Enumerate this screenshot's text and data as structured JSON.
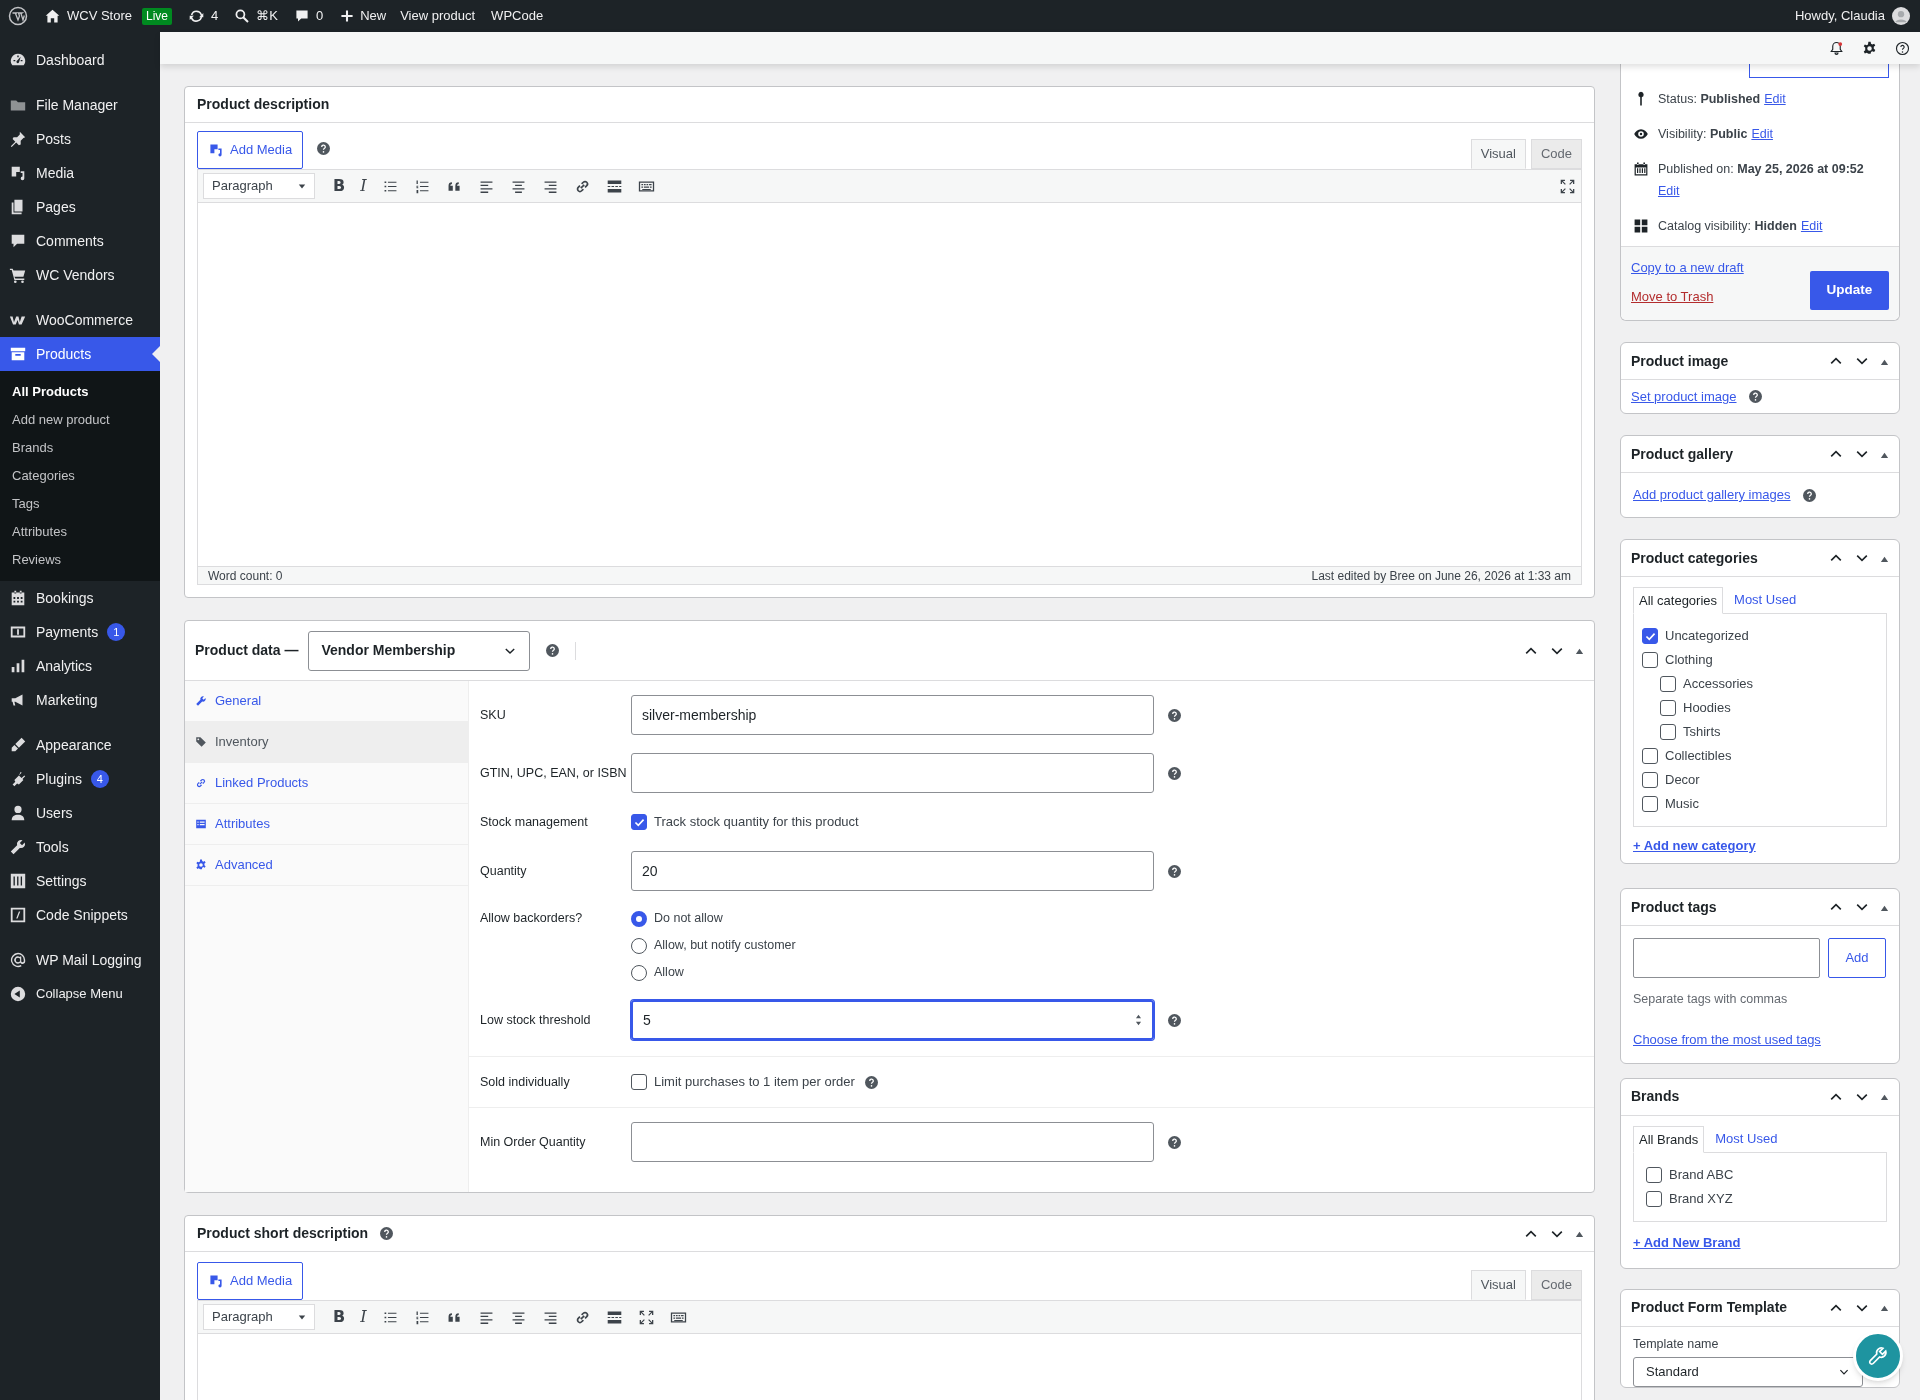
{
  "admin_bar": {
    "site": "WCV Store",
    "badge": "Live",
    "updates": "4",
    "search": "⌘K",
    "comments": "0",
    "new": "New",
    "links": [
      "View product",
      "WPCode"
    ],
    "account": "Howdy, Claudia"
  },
  "sidebar": {
    "groups": [
      [
        {
          "label": "Dashboard",
          "selected": false
        }
      ],
      [
        {
          "label": "File Manager",
          "selected": false
        },
        {
          "label": "Posts",
          "selected": false
        },
        {
          "label": "Media",
          "selected": false
        },
        {
          "label": "Pages",
          "selected": false
        },
        {
          "label": "Comments",
          "selected": false
        },
        {
          "label": "WC Vendors",
          "selected": false
        }
      ],
      [
        {
          "label": "WooCommerce",
          "selected": false
        },
        {
          "label": "Products",
          "selected": true,
          "children": [
            {
              "label": "All Products",
              "selected": true
            },
            {
              "label": "Add new product",
              "selected": false
            },
            {
              "label": "Brands",
              "selected": false
            },
            {
              "label": "Categories",
              "selected": false
            },
            {
              "label": "Tags",
              "selected": false
            },
            {
              "label": "Attributes",
              "selected": false
            },
            {
              "label": "Reviews",
              "selected": false
            }
          ]
        },
        {
          "label": "Bookings",
          "selected": false
        },
        {
          "label": "Payments",
          "selected": false,
          "badge": "1"
        },
        {
          "label": "Analytics",
          "selected": false
        },
        {
          "label": "Marketing",
          "selected": false
        }
      ],
      [
        {
          "label": "Appearance",
          "selected": false
        },
        {
          "label": "Plugins",
          "selected": false,
          "badge": "4"
        },
        {
          "label": "Users",
          "selected": false
        },
        {
          "label": "Tools",
          "selected": false
        },
        {
          "label": "Settings",
          "selected": false
        },
        {
          "label": "Code Snippets",
          "selected": false
        }
      ],
      [
        {
          "label": "WP Mail Logging",
          "selected": false
        }
      ]
    ],
    "collapse": "Collapse Menu"
  },
  "description": {
    "title": "Product description",
    "add_media": "Add Media",
    "tabs": [
      {
        "label": "Visual",
        "selected": true
      },
      {
        "label": "Code",
        "selected": false
      }
    ],
    "toolbar": {
      "format": "Paragraph",
      "bold": "B",
      "italic": "I"
    },
    "word_count": "Word count: 0",
    "last_edited": "Last edited by Bree on June 26, 2026 at 1:33 am"
  },
  "product_data": {
    "title": "Product data —",
    "type": "Vendor Membership",
    "tabs": [
      {
        "label": "General",
        "selected": false
      },
      {
        "label": "Inventory",
        "selected": true
      },
      {
        "label": "Linked Products",
        "selected": false
      },
      {
        "label": "Attributes",
        "selected": false
      },
      {
        "label": "Advanced",
        "selected": false
      }
    ],
    "field_groups": [
      [
        {
          "kind": "text",
          "label": "SKU",
          "value": "silver-membership",
          "focused": false
        },
        {
          "kind": "text",
          "label": "GTIN, UPC, EAN, or ISBN",
          "focused": false
        },
        {
          "kind": "checkbox",
          "label": "Stock management",
          "text": "Track stock quantity for this product",
          "checked": true,
          "help": false
        },
        {
          "kind": "text",
          "label": "Quantity",
          "value": "20",
          "focused": false
        },
        {
          "kind": "radio",
          "label": "Allow backorders?",
          "options": [
            {
              "label": "Do not allow",
              "selected": true
            },
            {
              "label": "Allow, but notify customer",
              "selected": false
            },
            {
              "label": "Allow",
              "selected": false
            }
          ]
        },
        {
          "kind": "number",
          "label": "Low stock threshold",
          "value": "5",
          "focused": true
        }
      ],
      [
        {
          "kind": "checkbox",
          "label": "Sold individually",
          "text": "Limit purchases to 1 item per order",
          "checked": false,
          "help": true
        }
      ],
      [
        {
          "kind": "text",
          "label": "Min Order Quantity",
          "focused": false
        }
      ]
    ]
  },
  "short_description": {
    "title": "Product short description",
    "add_media": "Add Media",
    "tabs": [
      {
        "label": "Visual",
        "selected": true
      },
      {
        "label": "Code",
        "selected": false
      }
    ],
    "toolbar": {
      "format": "Paragraph",
      "bold": "B",
      "italic": "I"
    }
  },
  "publish": {
    "rows": [
      {
        "text": "Status: **Published**",
        "link": "Edit"
      },
      {
        "text": "Visibility: **Public**",
        "link": "Edit"
      },
      {
        "text": "Published on: **May 25, 2026 at 09:52**",
        "link": "Edit"
      },
      {
        "text": "Catalog visibility: **Hidden**",
        "link": "Edit"
      }
    ],
    "copy": "Copy to a new draft",
    "trash": "Move to Trash",
    "update": "Update"
  },
  "product_image": {
    "title": "Product image",
    "link": "Set product image"
  },
  "product_gallery": {
    "title": "Product gallery",
    "link": "Add product gallery images"
  },
  "categories": {
    "title": "Product categories",
    "tabs": [
      {
        "label": "All categories",
        "selected": true
      },
      {
        "label": "Most Used",
        "selected": false
      }
    ],
    "items": [
      {
        "label": "Uncategorized",
        "checked": true
      },
      {
        "label": "Clothing",
        "checked": false,
        "children": [
          {
            "label": "Accessories",
            "checked": false
          },
          {
            "label": "Hoodies",
            "checked": false
          },
          {
            "label": "Tshirts",
            "checked": false
          }
        ]
      },
      {
        "label": "Collectibles",
        "checked": false
      },
      {
        "label": "Decor",
        "checked": false
      },
      {
        "label": "Music",
        "checked": false
      }
    ],
    "add": "+ Add new category"
  },
  "tags": {
    "title": "Product tags",
    "add": "Add",
    "hint": "Separate tags with commas",
    "link": "Choose from the most used tags"
  },
  "brands": {
    "title": "Brands",
    "tabs": [
      {
        "label": "All Brands",
        "selected": true
      },
      {
        "label": "Most Used",
        "selected": false
      }
    ],
    "items": [
      {
        "label": "Brand ABC",
        "checked": false
      },
      {
        "label": "Brand XYZ",
        "checked": false
      }
    ],
    "add": "+ Add New Brand"
  },
  "form_template": {
    "title": "Product Form Template",
    "label": "Template name",
    "value": "Standard"
  }
}
